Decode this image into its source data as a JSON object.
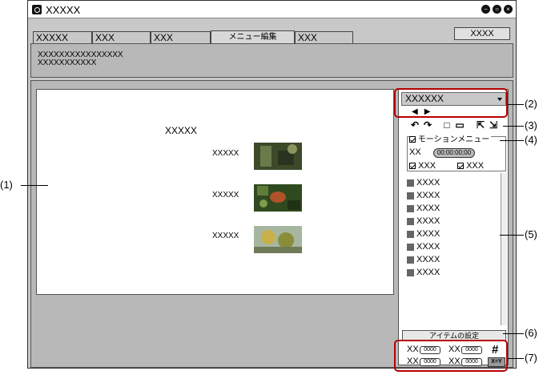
{
  "window": {
    "title": "XXXXX"
  },
  "tabs": [
    {
      "label": "XXXXX"
    },
    {
      "label": "XXX"
    },
    {
      "label": "XXX"
    },
    {
      "label": "メニュー編集"
    },
    {
      "label": "XXX"
    }
  ],
  "top_button": "XXXX",
  "description": {
    "line1": "XXXXXXXXXXXXXXXX",
    "line2": "XXXXXXXXXXX"
  },
  "preview": {
    "title": "XXXXX",
    "items": [
      {
        "label": "XXXXX"
      },
      {
        "label": "XXXXX"
      },
      {
        "label": "XXXXX"
      }
    ]
  },
  "panel": {
    "dropdown": "XXXXXX",
    "motion": {
      "label": "モーションメニュー",
      "time_label": "XX",
      "time_value": "00:00:00;00",
      "check1": "XXX",
      "check2": "XXX"
    },
    "list": [
      "XXXX",
      "XXXX",
      "XXXX",
      "XXXX",
      "XXXX",
      "XXXX",
      "XXXX",
      "XXXX"
    ],
    "item_settings": "アイテムの設定",
    "coords": {
      "l1": "XX",
      "v1": "0000",
      "l2": "XX",
      "v2": "0000",
      "l3": "XX",
      "v3": "0000",
      "l4": "XX",
      "v4": "0000",
      "eq": "X=Y"
    }
  },
  "labels": {
    "c1": "(1)",
    "c2": "(2)",
    "c3": "(3)",
    "c4": "(4)",
    "c5": "(5)",
    "c6": "(6)",
    "c7": "(7)"
  },
  "colors": {
    "callout": "#b60000",
    "panel": "#c8c8c8"
  }
}
